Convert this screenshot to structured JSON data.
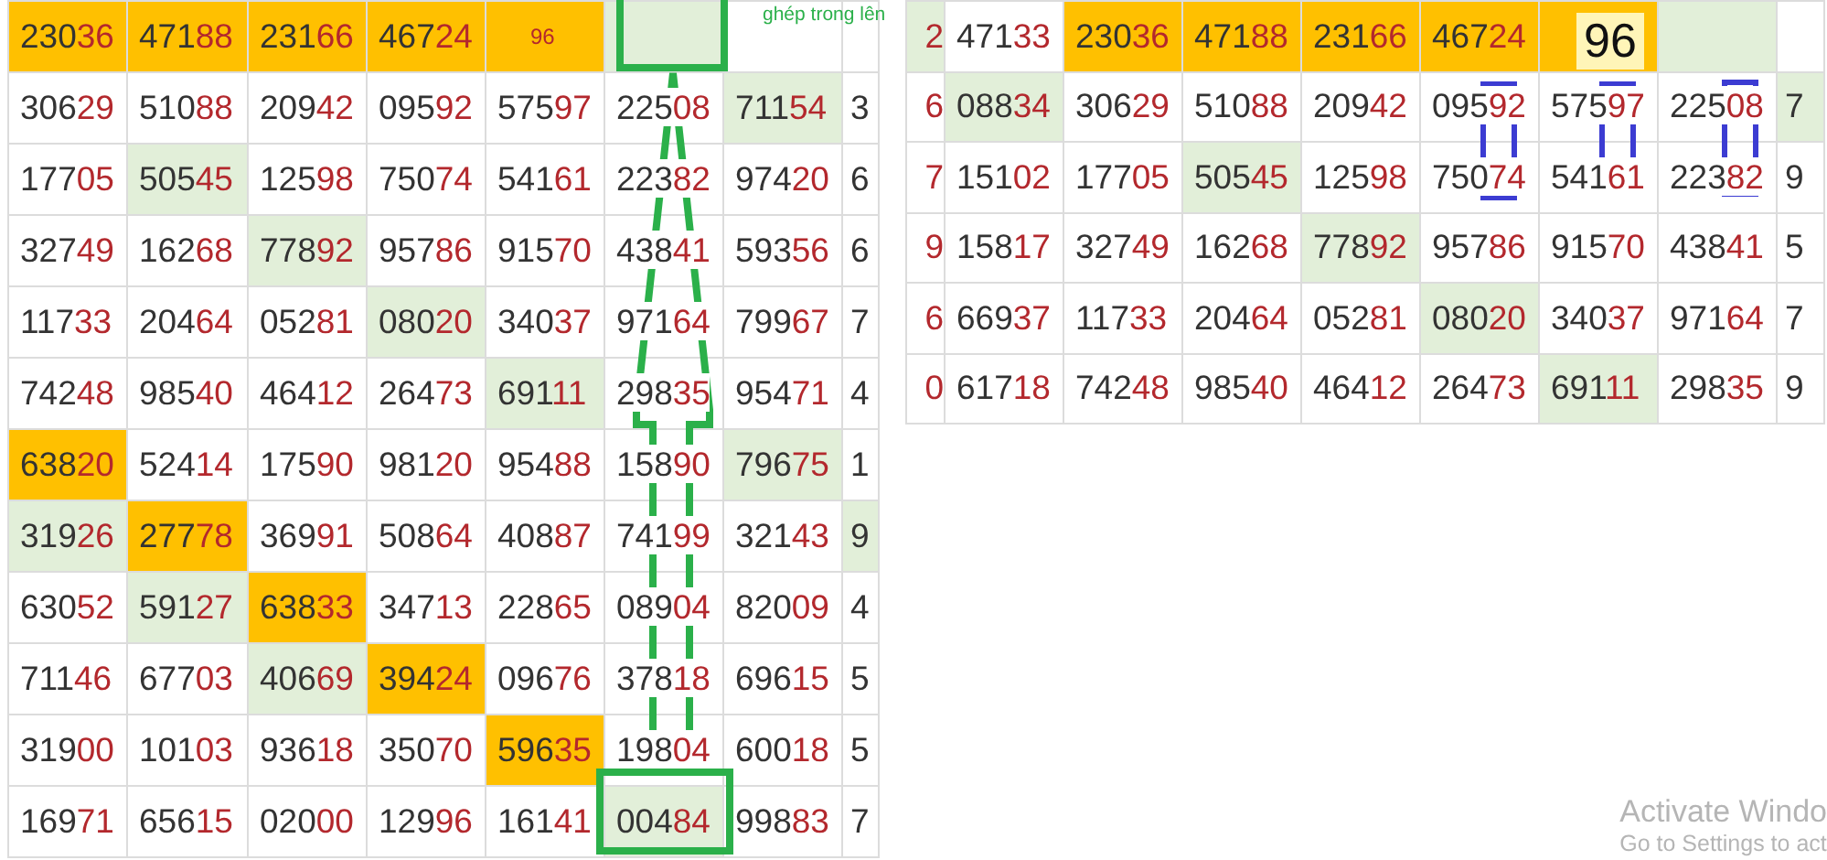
{
  "left_table": {
    "note": "ghép trong lên",
    "rows": [
      [
        {
          "text": "23036",
          "color": "#ffc000"
        },
        {
          "text": "47188",
          "color": "#ffc000"
        },
        {
          "text": "23166",
          "color": "#ffc000"
        },
        {
          "text": "46724",
          "color": "#ffc000"
        },
        {
          "text": "96",
          "color": "#ffc000",
          "kind": "small"
        },
        {
          "color": "#e2efd9"
        },
        {},
        {}
      ],
      [
        {
          "text": "30629"
        },
        {
          "text": "51088"
        },
        {
          "text": "20942"
        },
        {
          "text": "09592"
        },
        {
          "text": "57597"
        },
        {
          "text": "22508"
        },
        {
          "text": "71154",
          "color": "#e2efd9"
        },
        {
          "text": "3",
          "kind": "edge"
        }
      ],
      [
        {
          "text": "17705"
        },
        {
          "text": "50545",
          "color": "#e2efd9"
        },
        {
          "text": "12598"
        },
        {
          "text": "75074"
        },
        {
          "text": "54161"
        },
        {
          "text": "22382"
        },
        {
          "text": "97420"
        },
        {
          "text": "6",
          "kind": "edge"
        }
      ],
      [
        {
          "text": "32749"
        },
        {
          "text": "16268"
        },
        {
          "text": "77892",
          "color": "#e2efd9"
        },
        {
          "text": "95786"
        },
        {
          "text": "91570"
        },
        {
          "text": "43841"
        },
        {
          "text": "59356"
        },
        {
          "text": "6",
          "kind": "edge"
        }
      ],
      [
        {
          "text": "11733"
        },
        {
          "text": "20464"
        },
        {
          "text": "05281"
        },
        {
          "text": "08020",
          "color": "#e2efd9"
        },
        {
          "text": "34037"
        },
        {
          "text": "97164"
        },
        {
          "text": "79967"
        },
        {
          "text": "7",
          "kind": "edge"
        }
      ],
      [
        {
          "text": "74248"
        },
        {
          "text": "98540"
        },
        {
          "text": "46412"
        },
        {
          "text": "26473"
        },
        {
          "text": "69111",
          "color": "#e2efd9"
        },
        {
          "text": "29835"
        },
        {
          "text": "95471"
        },
        {
          "text": "4",
          "kind": "edge"
        }
      ],
      [
        {
          "text": "63820",
          "color": "#ffc000"
        },
        {
          "text": "52414"
        },
        {
          "text": "17590"
        },
        {
          "text": "98120"
        },
        {
          "text": "95488"
        },
        {
          "text": "15890"
        },
        {
          "text": "79675",
          "color": "#e2efd9"
        },
        {
          "text": "1",
          "kind": "edge"
        }
      ],
      [
        {
          "text": "31926",
          "color": "#e2efd9"
        },
        {
          "text": "27778",
          "color": "#ffc000"
        },
        {
          "text": "36991"
        },
        {
          "text": "50864"
        },
        {
          "text": "40887"
        },
        {
          "text": "74199"
        },
        {
          "text": "32143"
        },
        {
          "text": "9",
          "kind": "edge",
          "color": "#e2efd9"
        }
      ],
      [
        {
          "text": "63052"
        },
        {
          "text": "59127",
          "color": "#e2efd9"
        },
        {
          "text": "63833",
          "color": "#ffc000"
        },
        {
          "text": "34713"
        },
        {
          "text": "22865"
        },
        {
          "text": "08904"
        },
        {
          "text": "82009"
        },
        {
          "text": "4",
          "kind": "edge"
        }
      ],
      [
        {
          "text": "71146"
        },
        {
          "text": "67703"
        },
        {
          "text": "40669",
          "color": "#e2efd9"
        },
        {
          "text": "39424",
          "color": "#ffc000"
        },
        {
          "text": "09676"
        },
        {
          "text": "37818"
        },
        {
          "text": "69615"
        },
        {
          "text": "5",
          "kind": "edge"
        }
      ],
      [
        {
          "text": "31900"
        },
        {
          "text": "10103"
        },
        {
          "text": "93618"
        },
        {
          "text": "35070"
        },
        {
          "text": "59635",
          "color": "#ffc000"
        },
        {
          "text": "19804"
        },
        {
          "text": "60018"
        },
        {
          "text": "5",
          "kind": "edge"
        }
      ],
      [
        {
          "text": "16971"
        },
        {
          "text": "65615"
        },
        {
          "text": "02000"
        },
        {
          "text": "12996"
        },
        {
          "text": "16141"
        },
        {
          "text": "00484",
          "color": "#e2efd9"
        },
        {
          "text": "99883"
        },
        {
          "text": "7",
          "kind": "edge"
        }
      ]
    ]
  },
  "right_table": {
    "sticker": "96",
    "rows": [
      [
        {
          "text": "2",
          "color": "#e2efd9"
        },
        {
          "text": "47133"
        },
        {
          "text": "23036",
          "color": "#ffc000"
        },
        {
          "text": "47188",
          "color": "#ffc000"
        },
        {
          "text": "23166",
          "color": "#ffc000"
        },
        {
          "text": "46724",
          "color": "#ffc000"
        },
        {
          "color": "#ffc000"
        },
        {
          "color": "#e2efd9"
        },
        {}
      ],
      [
        {
          "text": "6"
        },
        {
          "text": "08834",
          "color": "#e2efd9"
        },
        {
          "text": "30629"
        },
        {
          "text": "51088"
        },
        {
          "text": "20942"
        },
        {
          "text": "09592"
        },
        {
          "text": "57597"
        },
        {
          "text": "22508"
        },
        {
          "text": "7",
          "kind": "edge",
          "color": "#e2efd9"
        }
      ],
      [
        {
          "text": "7"
        },
        {
          "text": "15102"
        },
        {
          "text": "17705"
        },
        {
          "text": "50545",
          "color": "#e2efd9"
        },
        {
          "text": "12598"
        },
        {
          "text": "75074"
        },
        {
          "text": "54161"
        },
        {
          "text": "22382"
        },
        {
          "text": "9",
          "kind": "edge"
        }
      ],
      [
        {
          "text": "9"
        },
        {
          "text": "15817"
        },
        {
          "text": "32749"
        },
        {
          "text": "16268"
        },
        {
          "text": "77892",
          "color": "#e2efd9"
        },
        {
          "text": "95786"
        },
        {
          "text": "91570"
        },
        {
          "text": "43841"
        },
        {
          "text": "5",
          "kind": "edge"
        }
      ],
      [
        {
          "text": "6"
        },
        {
          "text": "66937"
        },
        {
          "text": "11733"
        },
        {
          "text": "20464"
        },
        {
          "text": "05281"
        },
        {
          "text": "08020",
          "color": "#e2efd9"
        },
        {
          "text": "34037"
        },
        {
          "text": "97164"
        },
        {
          "text": "7",
          "kind": "edge"
        }
      ],
      [
        {
          "text": "0"
        },
        {
          "text": "61718"
        },
        {
          "text": "74248"
        },
        {
          "text": "98540"
        },
        {
          "text": "46412"
        },
        {
          "text": "26473"
        },
        {
          "text": "69111",
          "color": "#e2efd9"
        },
        {
          "text": "29835"
        },
        {
          "text": "9",
          "kind": "edge"
        }
      ]
    ]
  },
  "os_notice": {
    "title": "Activate Windo",
    "subtitle": "Go to Settings to act"
  }
}
